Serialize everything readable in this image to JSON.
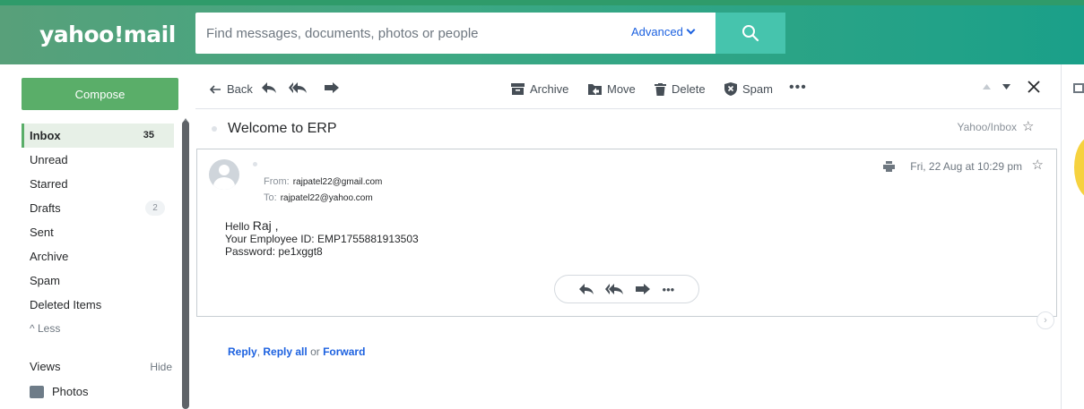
{
  "app": {
    "logo": "yahoo!mail"
  },
  "search": {
    "placeholder": "Find messages, documents, photos or people",
    "advanced_label": "Advanced"
  },
  "sidebar": {
    "compose_label": "Compose",
    "items": [
      {
        "label": "Inbox",
        "count": "35"
      },
      {
        "label": "Unread"
      },
      {
        "label": "Starred"
      },
      {
        "label": "Drafts",
        "count": "2"
      },
      {
        "label": "Sent"
      },
      {
        "label": "Archive"
      },
      {
        "label": "Spam"
      },
      {
        "label": "Deleted Items"
      }
    ],
    "less_label": "Less",
    "views_label": "Views",
    "hide_label": "Hide",
    "photos_label": "Photos"
  },
  "toolbar": {
    "back_label": "Back",
    "archive_label": "Archive",
    "move_label": "Move",
    "delete_label": "Delete",
    "spam_label": "Spam"
  },
  "message": {
    "subject": "Welcome to ERP",
    "folder": "Yahoo/Inbox",
    "from_label": "From:",
    "from": "rajpatel22@gmail.com",
    "to_label": "To:",
    "to": "rajpatel22@yahoo.com",
    "date": "Fri, 22 Aug at 10:29 pm",
    "greeting": "Hello",
    "greeting_name": "Raj ,",
    "employee_line": "Your Employee ID: EMP1755881913503",
    "password_line": "Password: pe1xggt8"
  },
  "quick_reply": {
    "reply": "Reply",
    "reply_all": "Reply all",
    "or": "or",
    "forward": "Forward"
  },
  "colors": {
    "header_green": "#3ea883",
    "compose_green": "#5aae69",
    "link_blue": "#1d62e0",
    "search_btn": "#46c4ad"
  }
}
